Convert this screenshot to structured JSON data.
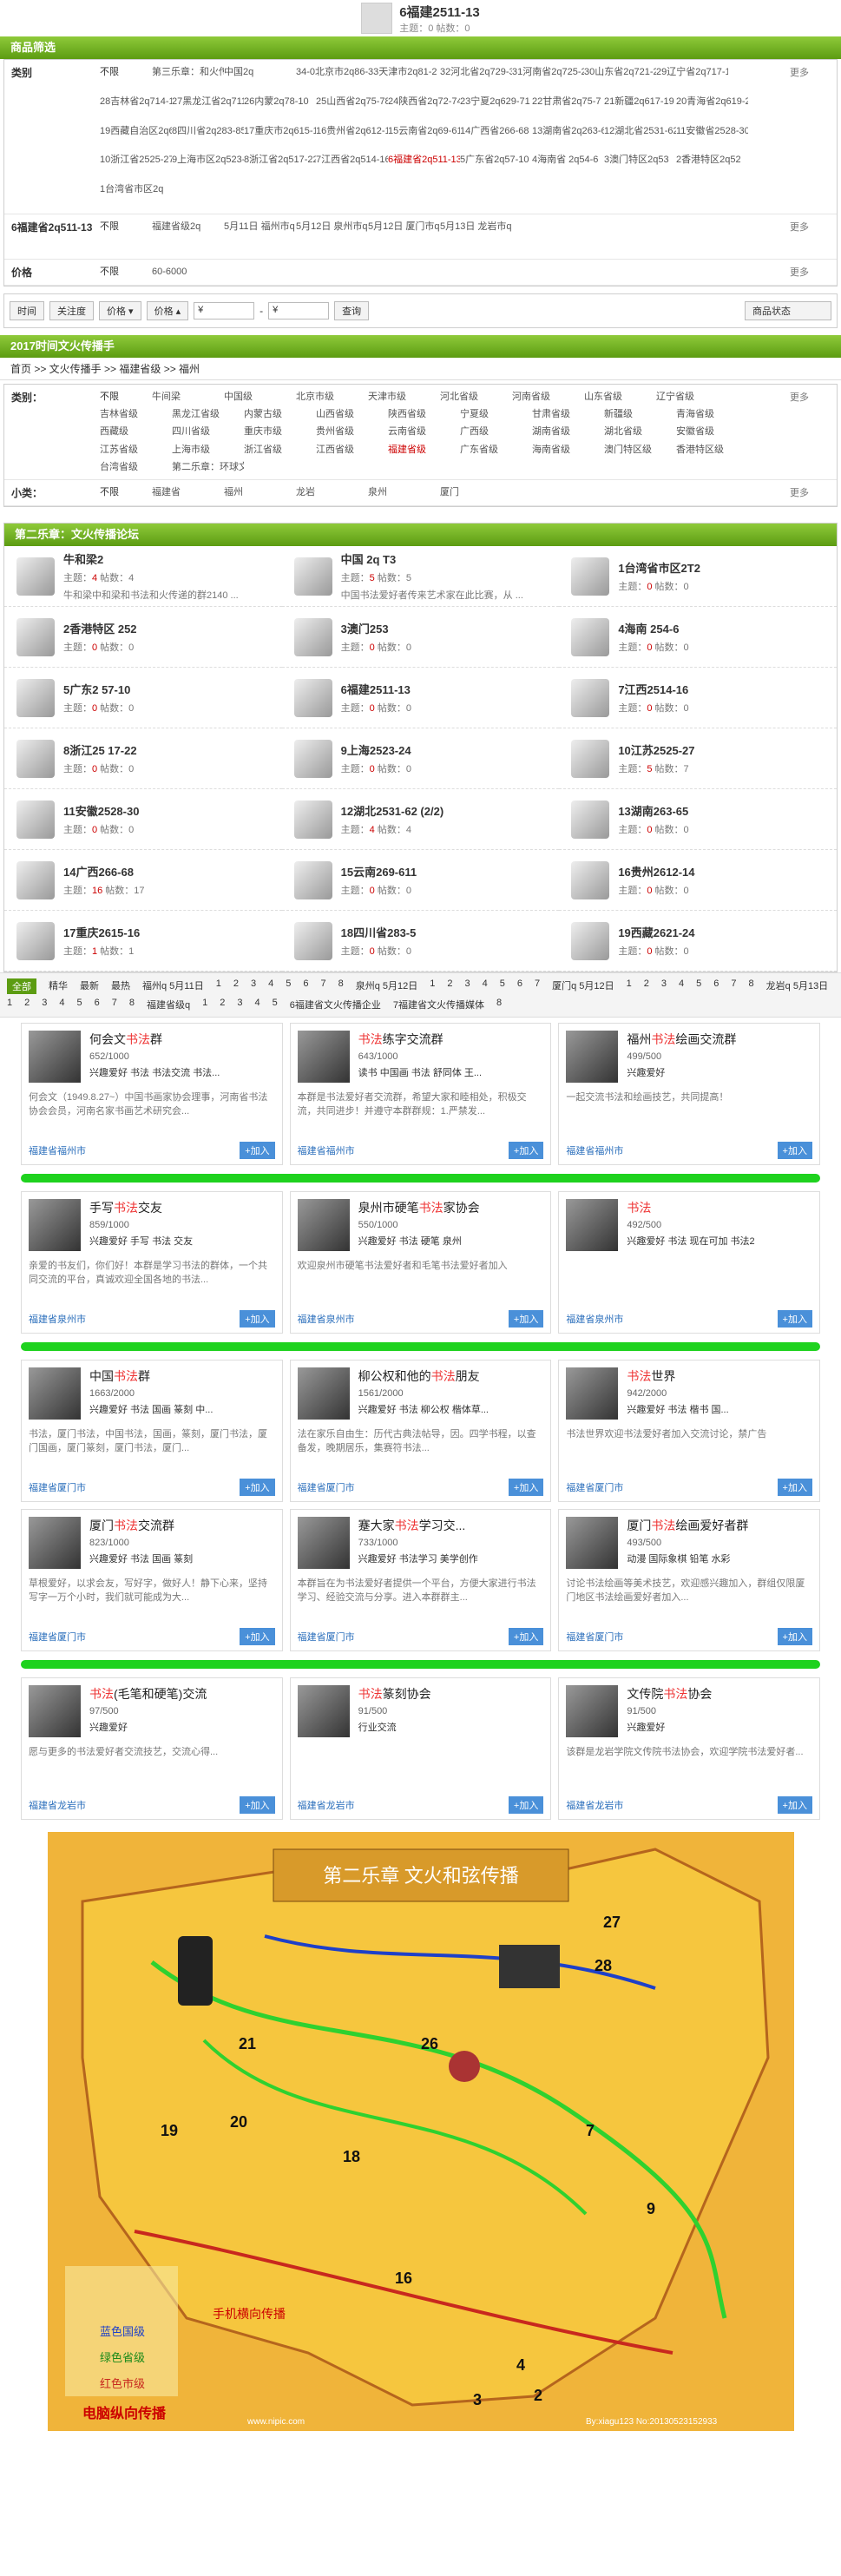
{
  "top": {
    "title": "6福建2511-13",
    "meta": "主题：0  帖数：0"
  },
  "filter": {
    "header": "商品筛选",
    "category_label": "类别",
    "cats": [
      "不限",
      "第三乐章：和火传递",
      "中国2q",
      "34-0北京市2q86-8",
      "33天津市2q81-2",
      "32河北省2q729-31",
      "31河南省2q725-28",
      "30山东省2q721-23",
      "29辽宁省2q717-19",
      "28吉林省2q714-16",
      "27黑龙江省2q711-13",
      "26内蒙2q78-10",
      "25山西省2q75-78",
      "24陕西省2q72-74",
      "23宁夏2q629-71",
      "22甘肃省2q75-7",
      "21新疆2q617-19",
      "20青海省2q619-21",
      "19西藏自治区2q621-24",
      "8四川省2q283-85",
      "17重庆市2q615-16",
      "16贵州省2q612-14",
      "15云南省2q69-611",
      "14广西省266-68",
      "13湖南省2q263-65",
      "12湖北省2531-62",
      "11安徽省2528-30",
      "10浙江省2525-27",
      "9上海市区2q523-24",
      "8浙江省2q517-22",
      "7江西省2q514-16",
      "6福建省2q511-13",
      "5广东省2q57-10",
      "4海南省 2q54-6",
      "3澳门特区2q53",
      "2香港特区2q52",
      "1台湾省市区2q"
    ],
    "prov_label": "6福建省2q511-13",
    "prov_opts": [
      "不限",
      "福建省级2q",
      "5月11日 福州市q",
      "5月12日 泉州市q",
      "5月12日 厦门市q",
      "5月13日 龙岩市q"
    ],
    "price_label": "价格",
    "price_opts": [
      "不限",
      "60-6000"
    ],
    "more": "更多"
  },
  "sortbar": {
    "b1": "时间",
    "b2": "关注度",
    "b3": "价格 ▾",
    "b4": "价格 ▴",
    "price_from": "¥",
    "price_to": "¥",
    "query": "查询",
    "status": "商品状态"
  },
  "section2": {
    "header": "2017时间文火传播手",
    "crumb": "首页  >>  文火传播手  >>  福建省级  >>  福州",
    "category_label": "类别：",
    "cats": [
      "不限",
      "牛间梁",
      "中国级",
      "北京市级",
      "天津市级",
      "河北省级",
      "河南省级",
      "山东省级",
      "辽宁省级",
      "吉林省级",
      "黑龙江省级",
      "内蒙古级",
      "山西省级",
      "陕西省级",
      "宁夏级",
      "甘肃省级",
      "新疆级",
      "青海省级",
      "西藏级",
      "四川省级",
      "重庆市级",
      "贵州省级",
      "云南省级",
      "广西级",
      "湖南省级",
      "湖北省级",
      "安徽省级",
      "江苏省级",
      "上海市级",
      "浙江省级",
      "江西省级",
      "福建省级",
      "广东省级",
      "海南省级",
      "澳门特区级",
      "香港特区级",
      "台湾省级",
      "第二乐章：环球文火传播者"
    ],
    "sub_label": "小类：",
    "subs": [
      "不限",
      "福建省",
      "福州",
      "龙岩",
      "泉州",
      "厦门"
    ]
  },
  "forums": {
    "header": "第二乐章：文火传播论坛",
    "items": [
      {
        "name": "牛和梁2",
        "t": "4",
        "p": "4",
        "desc": "牛和梁中和梁和书法和火传递的群2140 ..."
      },
      {
        "name": "中国 2q T3",
        "t": "5",
        "p": "5",
        "desc": "中国书法爱好者传来艺术家在此比赛，从 ..."
      },
      {
        "name": "1台湾省市区2T2",
        "t": "0",
        "p": "0",
        "desc": ""
      },
      {
        "name": "2香港特区 252",
        "t": "0",
        "p": "0",
        "desc": ""
      },
      {
        "name": "3澳门253",
        "t": "0",
        "p": "0",
        "desc": ""
      },
      {
        "name": "4海南 254-6",
        "t": "0",
        "p": "0",
        "desc": ""
      },
      {
        "name": "5广东2 57-10",
        "t": "0",
        "p": "0",
        "desc": ""
      },
      {
        "name": "6福建2511-13",
        "t": "0",
        "p": "0",
        "desc": ""
      },
      {
        "name": "7江西2514-16",
        "t": "0",
        "p": "0",
        "desc": ""
      },
      {
        "name": "8浙江25 17-22",
        "t": "0",
        "p": "0",
        "desc": ""
      },
      {
        "name": "9上海2523-24",
        "t": "0",
        "p": "0",
        "desc": ""
      },
      {
        "name": "10江苏2525-27",
        "t": "5",
        "p": "7",
        "desc": ""
      },
      {
        "name": "11安徽2528-30",
        "t": "0",
        "p": "0",
        "desc": ""
      },
      {
        "name": "12湖北2531-62 (2/2)",
        "t": "4",
        "p": "4",
        "desc": ""
      },
      {
        "name": "13湖南263-65",
        "t": "0",
        "p": "0",
        "desc": ""
      },
      {
        "name": "14广西266-68",
        "t": "16",
        "p": "17",
        "desc": ""
      },
      {
        "name": "15云南269-611",
        "t": "0",
        "p": "0",
        "desc": ""
      },
      {
        "name": "16贵州2612-14",
        "t": "0",
        "p": "0",
        "desc": ""
      },
      {
        "name": "17重庆2615-16",
        "t": "1",
        "p": "1",
        "desc": ""
      },
      {
        "name": "18四川省283-5",
        "t": "0",
        "p": "0",
        "desc": ""
      },
      {
        "name": "19西藏2621-24",
        "t": "0",
        "p": "0",
        "desc": ""
      }
    ],
    "t_label": "主题：",
    "p_label": "帖数："
  },
  "tabs": [
    "全部",
    "精华",
    "最新",
    "最热",
    "福州q 5月11日",
    "1",
    "2",
    "3",
    "4",
    "5",
    "6",
    "7",
    "8",
    "泉州q 5月12日",
    "1",
    "2",
    "3",
    "4",
    "5",
    "6",
    "7",
    "厦门q 5月12日",
    "1",
    "2",
    "3",
    "4",
    "5",
    "6",
    "7",
    "8",
    "龙岩q 5月13日",
    "1",
    "2",
    "3",
    "4",
    "5",
    "6",
    "7",
    "8",
    "福建省级q",
    "1",
    "2",
    "3",
    "4",
    "5",
    "6福建省文火传播企业",
    "7福建省文火传播媒体",
    "8"
  ],
  "groups": [
    [
      {
        "pre": "何会文",
        "kw": "书法",
        "post": "群",
        "stat": "652/1000",
        "tags": "兴趣爱好  书法  书法交流  书法...",
        "desc": "何会文（1949.8.27~）中国书画家协会理事，河南省书法协会会员，河南名家书画艺术研究会...",
        "loc": "福建省福州市",
        "join": "+加入"
      },
      {
        "pre": "",
        "kw": "书法",
        "post": "练字交流群",
        "stat": "643/1000",
        "tags": "读书  中国画  书法  舒同体  王...",
        "desc": "本群是书法爱好者交流群，希望大家和睦相处，积极交流，共同进步！并遵守本群群规：1.严禁发...",
        "loc": "福建省福州市",
        "join": "+加入"
      },
      {
        "pre": "福州",
        "kw": "书法",
        "post": "绘画交流群",
        "stat": "499/500",
        "tags": "兴趣爱好",
        "desc": "一起交流书法和绘画技艺，共同提高！",
        "loc": "福建省福州市",
        "join": "+加入"
      }
    ],
    [
      {
        "pre": "手写",
        "kw": "书法",
        "post": "交友",
        "stat": "859/1000",
        "tags": "兴趣爱好  手写  书法  交友",
        "desc": "亲爱的书友们，你们好！本群是学习书法的群体，一个共同交流的平台，真诚欢迎全国各地的书法...",
        "loc": "福建省泉州市",
        "join": "+加入"
      },
      {
        "pre": "泉州市硬笔",
        "kw": "书法",
        "post": "家协会",
        "stat": "550/1000",
        "tags": "兴趣爱好  书法  硬笔  泉州",
        "desc": "欢迎泉州市硬笔书法爱好者和毛笔书法爱好者加入",
        "loc": "福建省泉州市",
        "join": "+加入"
      },
      {
        "pre": "",
        "kw": "书法",
        "post": "",
        "stat": "492/500",
        "tags": "兴趣爱好  书法  现在可加  书法2",
        "desc": "",
        "loc": "福建省泉州市",
        "join": "+加入"
      }
    ],
    [
      {
        "pre": "中国",
        "kw": "书法",
        "post": "群",
        "stat": "1663/2000",
        "tags": "兴趣爱好  书法  国画  篆刻  中...",
        "desc": "书法，厦门书法，中国书法，国画，篆刻，厦门书法，厦门国画，厦门篆刻，厦门书法，厦门...",
        "loc": "福建省厦门市",
        "join": "+加入"
      },
      {
        "pre": "柳公权和他的",
        "kw": "书法",
        "post": "朋友",
        "stat": "1561/2000",
        "tags": "兴趣爱好  书法  柳公权  楷体草...",
        "desc": "法在家乐自由生：历代古典法帖导，因。四学书程，以查备发，晚期居乐，集赛符书法...",
        "loc": "福建省厦门市",
        "join": "+加入"
      },
      {
        "pre": "",
        "kw": "书法",
        "post": "世界",
        "stat": "942/2000",
        "tags": "兴趣爱好  书法  楷书  国...",
        "desc": "书法世界欢迎书法爱好者加入交流讨论，禁广告",
        "loc": "福建省厦门市",
        "join": "+加入"
      }
    ],
    [
      {
        "pre": "厦门",
        "kw": "书法",
        "post": "交流群",
        "stat": "823/1000",
        "tags": "兴趣爱好  书法  国画  篆刻",
        "desc": "草根爱好，以求会友，写好字，做好人！静下心来，坚持写字一万个小时，我们就可能成为大...",
        "loc": "福建省厦门市",
        "join": "+加入"
      },
      {
        "pre": "蹇大家",
        "kw": "书法",
        "post": "学习交...",
        "stat": "733/1000",
        "tags": "兴趣爱好  书法学习  美学创作",
        "desc": "本群旨在为书法爱好者提供一个平台，方便大家进行书法学习、经验交流与分享。进入本群群主...",
        "loc": "福建省厦门市",
        "join": "+加入"
      },
      {
        "pre": "厦门",
        "kw": "书法",
        "post": "绘画爱好者群",
        "stat": "493/500",
        "tags": "动漫  国际象棋  铅笔  水彩",
        "desc": "讨论书法绘画等美术技艺，欢迎感兴趣加入，群组仅限厦门地区书法绘画爱好者加入...",
        "loc": "福建省厦门市",
        "join": "+加入"
      }
    ],
    [
      {
        "pre": "",
        "kw": "书法",
        "post": "(毛笔和硬笔)交流",
        "stat": "97/500",
        "tags": "兴趣爱好",
        "desc": "愿与更多的书法爱好者交流技艺，交流心得...",
        "loc": "福建省龙岩市",
        "join": "+加入"
      },
      {
        "pre": "",
        "kw": "书法",
        "post": "篆刻协会",
        "stat": "91/500",
        "tags": "行业交流",
        "desc": "",
        "loc": "福建省龙岩市",
        "join": "+加入"
      },
      {
        "pre": "文传院",
        "kw": "书法",
        "post": "协会",
        "stat": "91/500",
        "tags": "兴趣爱好",
        "desc": "该群是龙岩学院文传院书法协会，欢迎学院书法爱好者...",
        "loc": "福建省龙岩市",
        "join": "+加入"
      }
    ]
  ],
  "map": {
    "title": "第二乐章  文火和弦传播",
    "legend": [
      "蓝色国级",
      "绿色省级",
      "红色市级"
    ],
    "side": "手机横向传播",
    "bottom": "电脑纵向传播",
    "watermark": "www.nipic.com",
    "credit": "By:xiagu123  No:20130523152933",
    "numbers": [
      "19",
      "20",
      "21",
      "26",
      "27",
      "28",
      "18",
      "16",
      "9",
      "7",
      "4",
      "3",
      "2"
    ]
  }
}
